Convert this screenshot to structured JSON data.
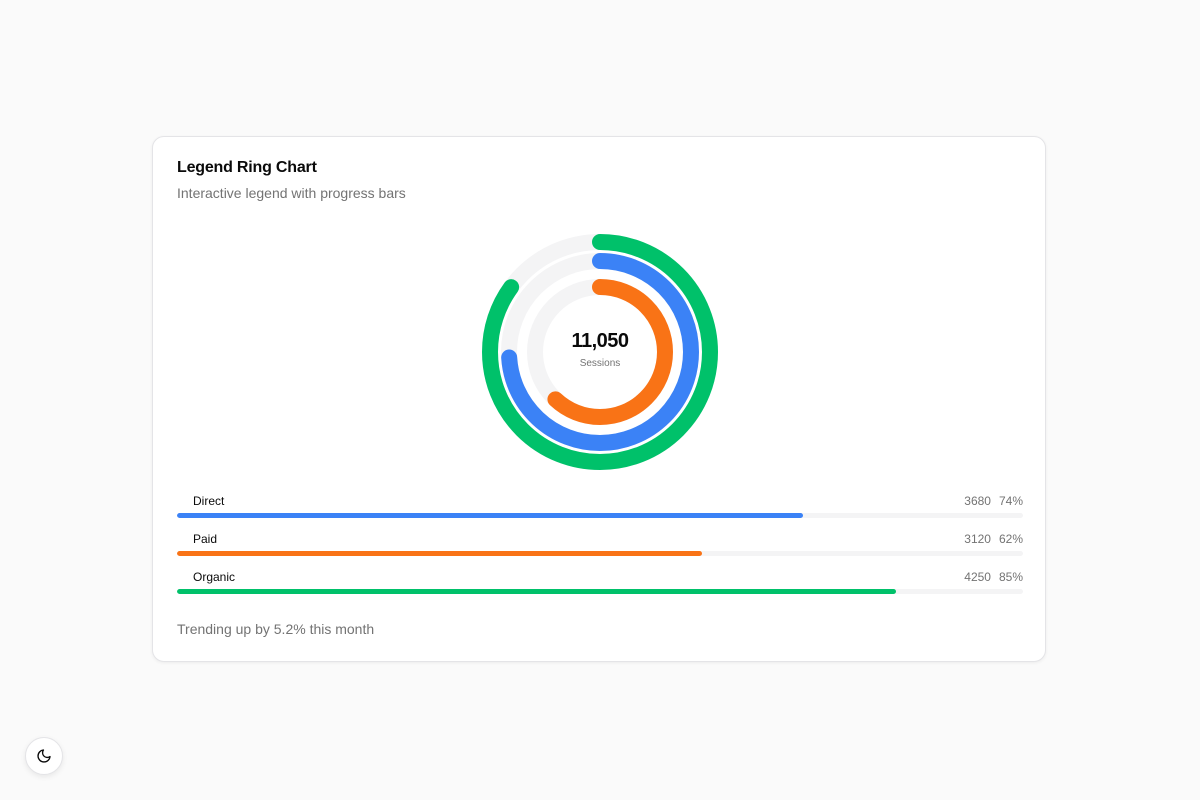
{
  "card": {
    "title": "Legend Ring Chart",
    "subtitle": "Interactive legend with progress bars",
    "footer": "Trending up by 5.2% this month"
  },
  "center": {
    "value": "11,050",
    "label": "Sessions"
  },
  "chart_data": {
    "type": "radial-bar",
    "title": "Legend Ring Chart",
    "subtitle": "Interactive legend with progress bars",
    "total": 11050,
    "total_label": "Sessions",
    "series": [
      {
        "name": "Direct",
        "value": 3680,
        "percent": 74,
        "percent_label": "74%",
        "color": "#3b82f6"
      },
      {
        "name": "Paid",
        "value": 3120,
        "percent": 62,
        "percent_label": "62%",
        "color": "#f97316"
      },
      {
        "name": "Organic",
        "value": 4250,
        "percent": 85,
        "percent_label": "85%",
        "color": "#00c16a"
      }
    ],
    "track_color": "#f4f4f5"
  },
  "theme_toggle": {
    "icon": "moon-icon"
  }
}
